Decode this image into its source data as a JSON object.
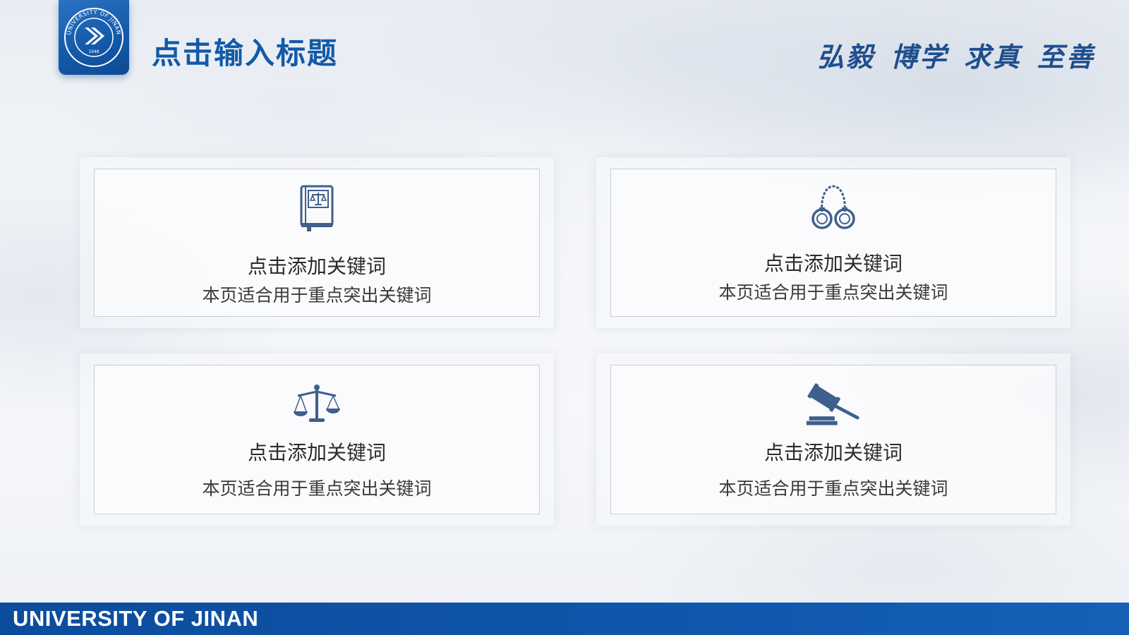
{
  "header": {
    "logo_name": "university-of-jinan-emblem",
    "logo_ring_text": "UNIVERSITY OF JINAN",
    "logo_year": "1948",
    "title": "点击输入标题",
    "motto": [
      "弘毅",
      "博学",
      "求真",
      "至善"
    ]
  },
  "cards": [
    {
      "icon": "law-book-icon",
      "title": "点击添加关键词",
      "description": "本页适合用于重点突出关键词"
    },
    {
      "icon": "handcuffs-icon",
      "title": "点击添加关键词",
      "description": "本页适合用于重点突出关键词"
    },
    {
      "icon": "scales-icon",
      "title": "点击添加关键词",
      "description": "本页适合用于重点突出关键词"
    },
    {
      "icon": "gavel-icon",
      "title": "点击添加关键词",
      "description": "本页适合用于重点突出关键词"
    }
  ],
  "footer": {
    "text": "UNIVERSITY OF JINAN"
  },
  "colors": {
    "brand_blue": "#125aa8",
    "footer_blue": "#0f57ad",
    "icon_blue": "#3f5f8c"
  }
}
